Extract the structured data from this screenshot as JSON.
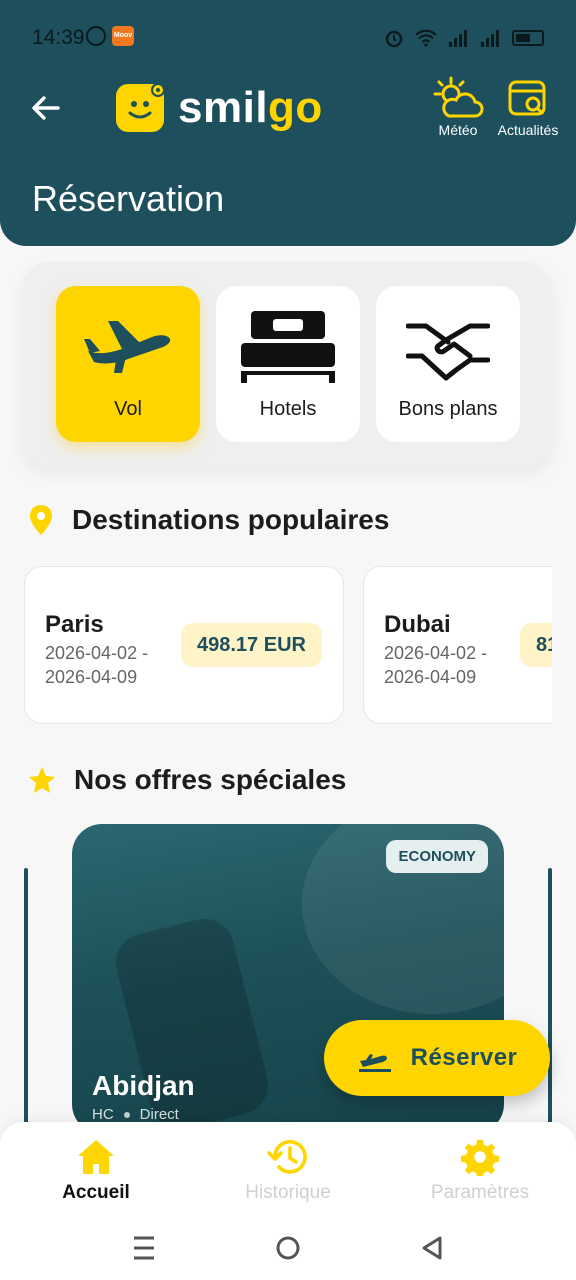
{
  "status": {
    "time": "14:39",
    "app_badge": "Moov"
  },
  "header": {
    "logo_text_a": "smil",
    "logo_text_b": "go",
    "title": "Réservation",
    "meteo_label": "Météo",
    "actus_label": "Actualités"
  },
  "categories": [
    {
      "label": "Vol",
      "icon": "airplane-icon",
      "active": true
    },
    {
      "label": "Hotels",
      "icon": "bed-icon",
      "active": false
    },
    {
      "label": "Bons plans",
      "icon": "handshake-icon",
      "active": false
    }
  ],
  "destinations": {
    "title": "Destinations populaires",
    "items": [
      {
        "city": "Paris",
        "dates": "2026-04-02 - 2026-04-09",
        "price": "498.17 EUR"
      },
      {
        "city": "Dubai",
        "dates": "2026-04-02 - 2026-04-09",
        "price": "81"
      }
    ]
  },
  "offers": {
    "title": "Nos offres spéciales",
    "card": {
      "badge": "ECONOMY",
      "city": "Abidjan",
      "code": "HC",
      "type": "Direct"
    },
    "reserve_label": "Réserver"
  },
  "nav": {
    "items": [
      {
        "label": "Accueil",
        "icon": "home-icon"
      },
      {
        "label": "Historique",
        "icon": "history-icon"
      },
      {
        "label": "Paramètres",
        "icon": "settings-icon"
      }
    ]
  },
  "colors": {
    "primary": "#1d4f5d",
    "accent": "#ffd500"
  }
}
